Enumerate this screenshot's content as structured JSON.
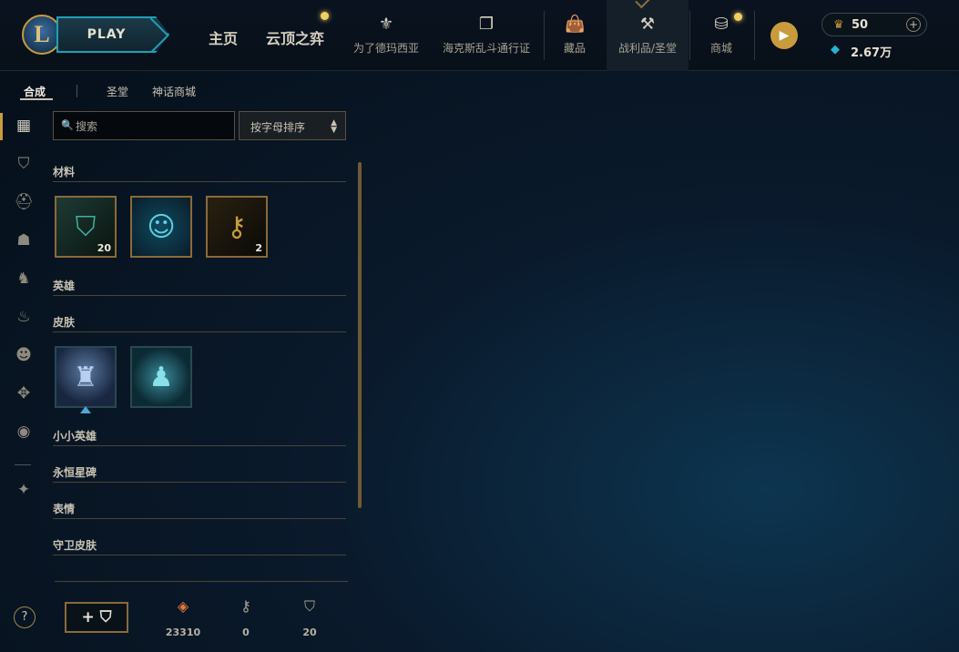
{
  "header": {
    "logo_letter": "L",
    "play_label": "PLAY",
    "nav_home": "主页",
    "nav_tft": "云顶之弈",
    "nav_items": [
      {
        "label": "为了德玛西亚",
        "icon": "demacia-icon"
      },
      {
        "label": "海克斯乱斗通行证",
        "icon": "pass-icon"
      },
      {
        "label": "藏品",
        "icon": "collection-icon"
      },
      {
        "label": "战利品/圣堂",
        "icon": "loot-icon"
      },
      {
        "label": "商城",
        "icon": "store-icon"
      }
    ],
    "active_nav": "战利品/圣堂",
    "currency": {
      "rp": "50",
      "blue_essence": "2.67万"
    }
  },
  "subtabs": [
    "合成",
    "圣堂",
    "神话商城"
  ],
  "search": {
    "placeholder": "搜索"
  },
  "sort": {
    "selected": "按字母排序"
  },
  "categories": [
    {
      "title": "材料",
      "items": [
        {
          "icon": "hextech-chest",
          "count": "20"
        },
        {
          "icon": "emote",
          "count": ""
        },
        {
          "icon": "key",
          "count": "2"
        }
      ]
    },
    {
      "title": "英雄",
      "items": []
    },
    {
      "title": "皮肤",
      "items": [
        {
          "icon": "skin-1"
        },
        {
          "icon": "skin-2"
        }
      ]
    },
    {
      "title": "小小英雄",
      "items": []
    },
    {
      "title": "永恒星碑",
      "items": []
    },
    {
      "title": "表情",
      "items": []
    },
    {
      "title": "守卫皮肤",
      "items": []
    }
  ],
  "resources": {
    "craft_label": "+ ⛉",
    "orange_essence": "23310",
    "keys": "0",
    "chests": "20"
  },
  "help_label": "?"
}
